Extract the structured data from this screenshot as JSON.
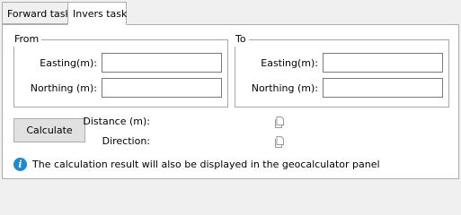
{
  "tabs": [
    {
      "label": "Forward task",
      "active": false
    },
    {
      "label": "Invers task",
      "active": true
    }
  ],
  "from": {
    "title": "From",
    "easting_label": "Easting(m):",
    "easting_value": "",
    "northing_label": "Northing (m):",
    "northing_value": ""
  },
  "to": {
    "title": "To",
    "easting_label": "Easting(m):",
    "easting_value": "",
    "northing_label": "Northing (m):",
    "northing_value": ""
  },
  "calculate_label": "Calculate",
  "results": {
    "distance_label": "Distance (m):",
    "direction_label": "Direction:",
    "copy_icon": "copy-icon"
  },
  "info": {
    "icon": "info-icon",
    "text": "The calculation result will also be displayed in the geocalculator panel",
    "icon_color": "#1b8ad8"
  }
}
